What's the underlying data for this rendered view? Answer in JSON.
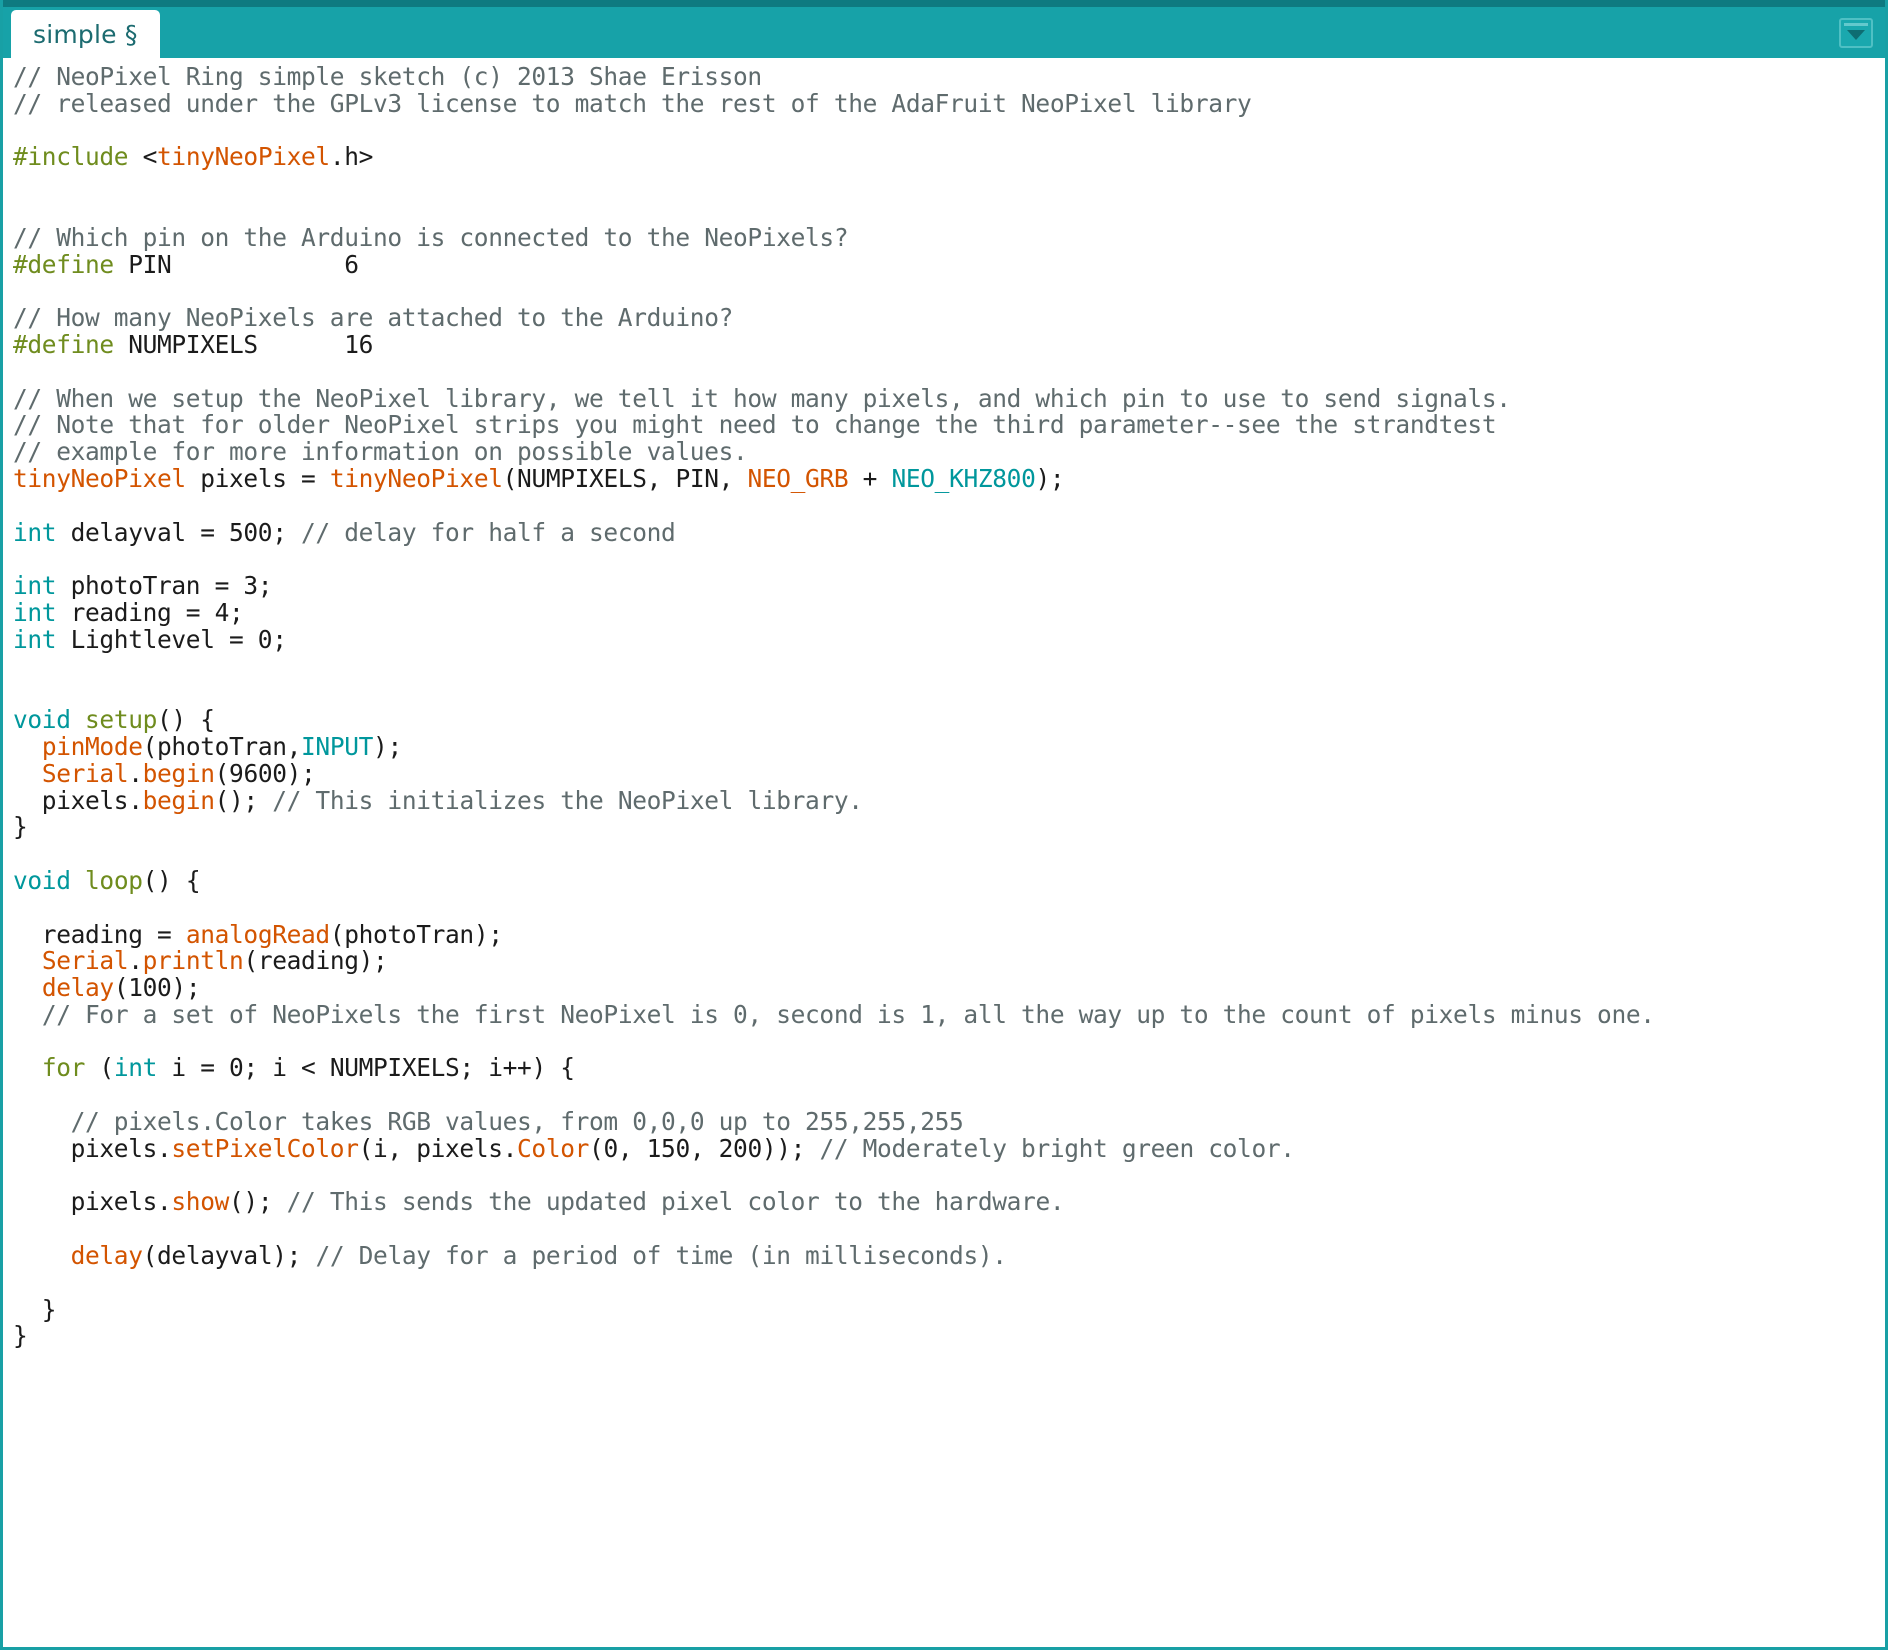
{
  "window": {
    "accent_color": "#17a2a8",
    "accent_dark": "#0e7a80",
    "background": "#ffffff"
  },
  "tabbar": {
    "tabs": [
      {
        "label": "simple §",
        "active": true
      }
    ],
    "menu_button": {
      "icon": "chevron-down-icon",
      "label": ""
    }
  },
  "editor": {
    "language": "arduino-cpp",
    "font_size_px": 24,
    "colors": {
      "comment": "#5f6b6d",
      "preprocessor": "#6f8c1e",
      "keyword": "#00979c",
      "function": "#d35400",
      "plain": "#1b1b1b"
    },
    "lines": [
      [
        {
          "t": "// NeoPixel Ring simple sketch (c) 2013 Shae Erisson",
          "k": "c"
        }
      ],
      [
        {
          "t": "// released under the GPLv3 license to match the rest of the AdaFruit NeoPixel library",
          "k": "c"
        }
      ],
      [],
      [
        {
          "t": "#include ",
          "k": "pp"
        },
        {
          "t": "<",
          "k": "id"
        },
        {
          "t": "tinyNeoPixel",
          "k": "fn"
        },
        {
          "t": ".h>",
          "k": "id"
        }
      ],
      [],
      [],
      [
        {
          "t": "// Which pin on the Arduino is connected to the NeoPixels?",
          "k": "c"
        }
      ],
      [
        {
          "t": "#define ",
          "k": "pp"
        },
        {
          "t": "PIN            6",
          "k": "id"
        }
      ],
      [],
      [
        {
          "t": "// How many NeoPixels are attached to the Arduino?",
          "k": "c"
        }
      ],
      [
        {
          "t": "#define ",
          "k": "pp"
        },
        {
          "t": "NUMPIXELS      16",
          "k": "id"
        }
      ],
      [],
      [
        {
          "t": "// When we setup the NeoPixel library, we tell it how many pixels, and which pin to use to send signals.",
          "k": "c"
        }
      ],
      [
        {
          "t": "// Note that for older NeoPixel strips you might need to change the third parameter--see the strandtest",
          "k": "c"
        }
      ],
      [
        {
          "t": "// example for more information on possible values.",
          "k": "c"
        }
      ],
      [
        {
          "t": "tinyNeoPixel",
          "k": "fn"
        },
        {
          "t": " pixels = ",
          "k": "id"
        },
        {
          "t": "tinyNeoPixel",
          "k": "fn"
        },
        {
          "t": "(NUMPIXELS, PIN, ",
          "k": "id"
        },
        {
          "t": "NEO_GRB",
          "k": "fn"
        },
        {
          "t": " + ",
          "k": "id"
        },
        {
          "t": "NEO_KHZ800",
          "k": "kw"
        },
        {
          "t": ");",
          "k": "id"
        }
      ],
      [],
      [
        {
          "t": "int",
          "k": "kw"
        },
        {
          "t": " delayval = 500; ",
          "k": "id"
        },
        {
          "t": "// delay for half a second",
          "k": "c"
        }
      ],
      [],
      [
        {
          "t": "int",
          "k": "kw"
        },
        {
          "t": " photoTran = 3;",
          "k": "id"
        }
      ],
      [
        {
          "t": "int",
          "k": "kw"
        },
        {
          "t": " reading = 4;",
          "k": "id"
        }
      ],
      [
        {
          "t": "int",
          "k": "kw"
        },
        {
          "t": " Lightlevel = 0;",
          "k": "id"
        }
      ],
      [],
      [],
      [
        {
          "t": "void",
          "k": "kw"
        },
        {
          "t": " ",
          "k": "id"
        },
        {
          "t": "setup",
          "k": "pp"
        },
        {
          "t": "() {",
          "k": "id"
        }
      ],
      [
        {
          "t": "  ",
          "k": "id"
        },
        {
          "t": "pinMode",
          "k": "fn"
        },
        {
          "t": "(photoTran,",
          "k": "id"
        },
        {
          "t": "INPUT",
          "k": "kw"
        },
        {
          "t": ");",
          "k": "id"
        }
      ],
      [
        {
          "t": "  ",
          "k": "id"
        },
        {
          "t": "Serial",
          "k": "fn"
        },
        {
          "t": ".",
          "k": "id"
        },
        {
          "t": "begin",
          "k": "fn"
        },
        {
          "t": "(9600);",
          "k": "id"
        }
      ],
      [
        {
          "t": "  pixels.",
          "k": "id"
        },
        {
          "t": "begin",
          "k": "fn"
        },
        {
          "t": "(); ",
          "k": "id"
        },
        {
          "t": "// This initializes the NeoPixel library.",
          "k": "c"
        }
      ],
      [
        {
          "t": "}",
          "k": "id"
        }
      ],
      [],
      [
        {
          "t": "void",
          "k": "kw"
        },
        {
          "t": " ",
          "k": "id"
        },
        {
          "t": "loop",
          "k": "pp"
        },
        {
          "t": "() {",
          "k": "id"
        }
      ],
      [],
      [
        {
          "t": "  reading = ",
          "k": "id"
        },
        {
          "t": "analogRead",
          "k": "fn"
        },
        {
          "t": "(photoTran);",
          "k": "id"
        }
      ],
      [
        {
          "t": "  ",
          "k": "id"
        },
        {
          "t": "Serial",
          "k": "fn"
        },
        {
          "t": ".",
          "k": "id"
        },
        {
          "t": "println",
          "k": "fn"
        },
        {
          "t": "(reading);",
          "k": "id"
        }
      ],
      [
        {
          "t": "  ",
          "k": "id"
        },
        {
          "t": "delay",
          "k": "fn"
        },
        {
          "t": "(100);",
          "k": "id"
        }
      ],
      [
        {
          "t": "  ",
          "k": "id"
        },
        {
          "t": "// For a set of NeoPixels the first NeoPixel is 0, second is 1, all the way up to the count of pixels minus one.",
          "k": "c"
        }
      ],
      [],
      [
        {
          "t": "  ",
          "k": "id"
        },
        {
          "t": "for",
          "k": "pp"
        },
        {
          "t": " (",
          "k": "id"
        },
        {
          "t": "int",
          "k": "kw"
        },
        {
          "t": " i = 0; i < NUMPIXELS; i++) {",
          "k": "id"
        }
      ],
      [],
      [
        {
          "t": "    ",
          "k": "id"
        },
        {
          "t": "// pixels.Color takes RGB values, from 0,0,0 up to 255,255,255",
          "k": "c"
        }
      ],
      [
        {
          "t": "    pixels.",
          "k": "id"
        },
        {
          "t": "setPixelColor",
          "k": "fn"
        },
        {
          "t": "(i, pixels.",
          "k": "id"
        },
        {
          "t": "Color",
          "k": "fn"
        },
        {
          "t": "(0, 150, 200)); ",
          "k": "id"
        },
        {
          "t": "// Moderately bright green color.",
          "k": "c"
        }
      ],
      [],
      [
        {
          "t": "    pixels.",
          "k": "id"
        },
        {
          "t": "show",
          "k": "fn"
        },
        {
          "t": "(); ",
          "k": "id"
        },
        {
          "t": "// This sends the updated pixel color to the hardware.",
          "k": "c"
        }
      ],
      [],
      [
        {
          "t": "    ",
          "k": "id"
        },
        {
          "t": "delay",
          "k": "fn"
        },
        {
          "t": "(delayval); ",
          "k": "id"
        },
        {
          "t": "// Delay for a period of time (in milliseconds).",
          "k": "c"
        }
      ],
      [],
      [
        {
          "t": "  }",
          "k": "id"
        }
      ],
      [
        {
          "t": "}",
          "k": "id"
        }
      ]
    ]
  }
}
